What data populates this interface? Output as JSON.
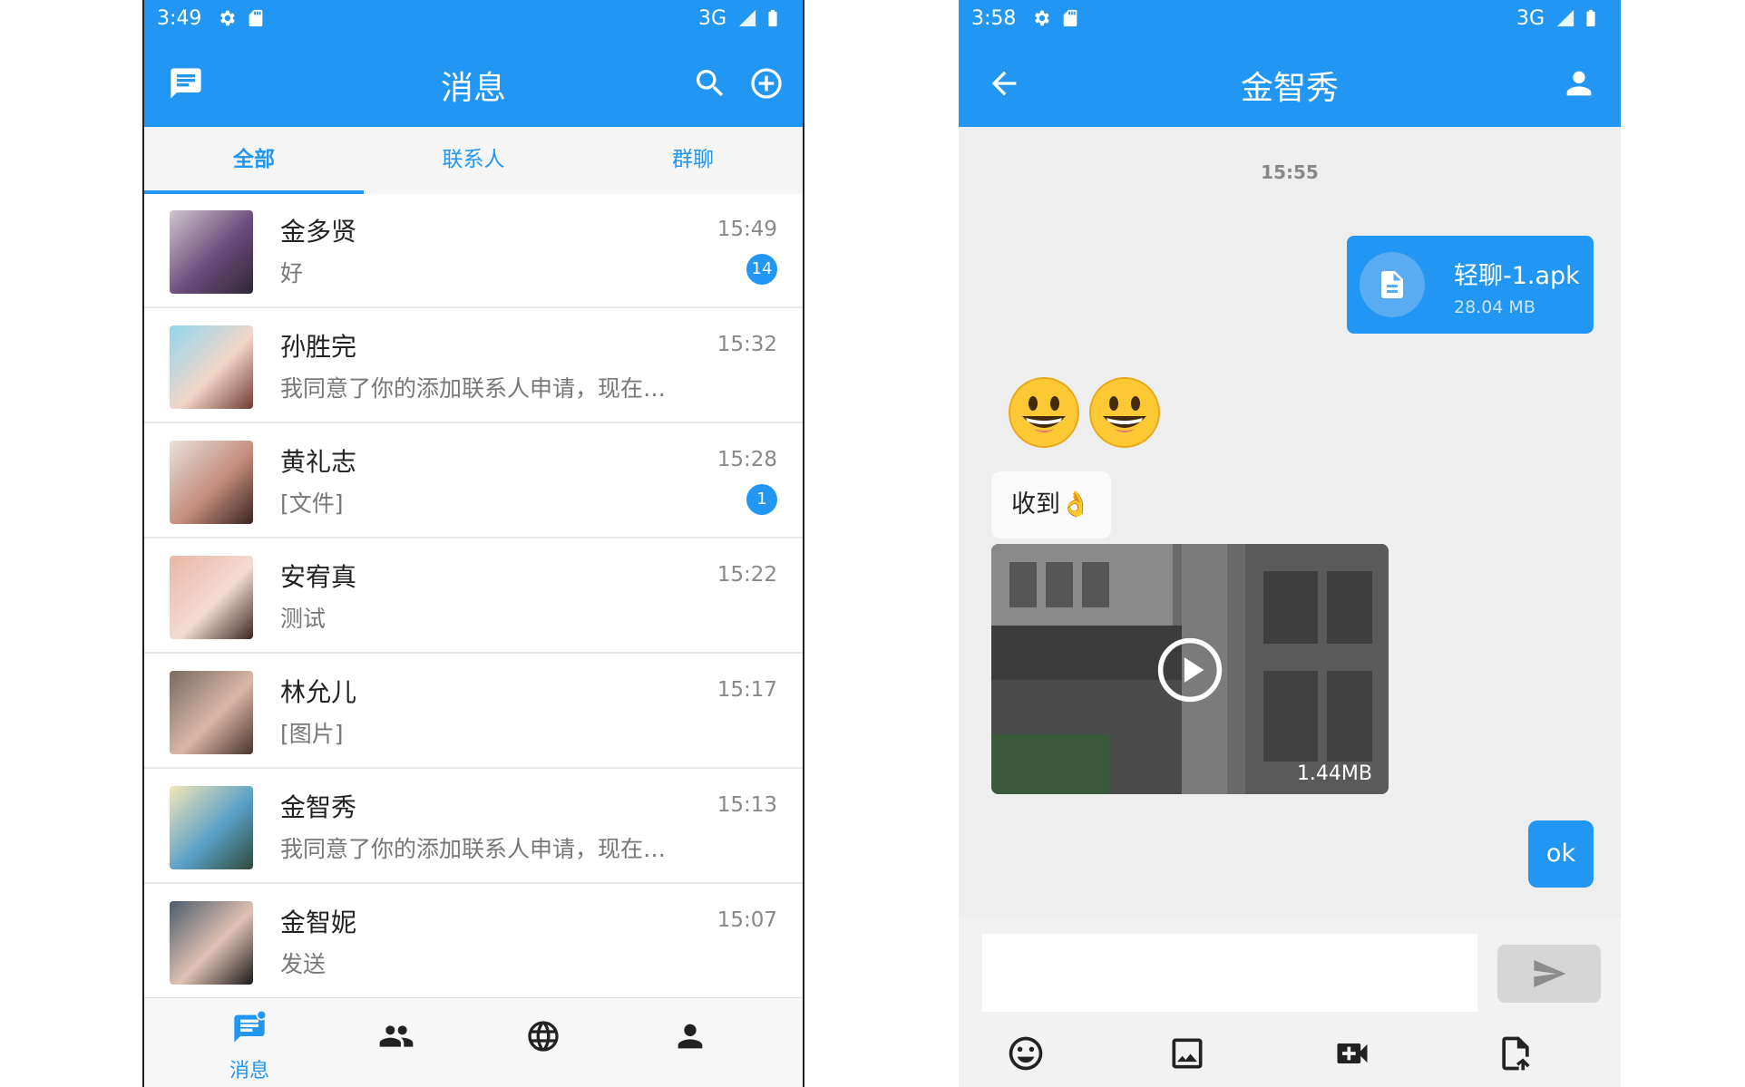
{
  "left": {
    "status": {
      "time": "3:49",
      "network": "3G"
    },
    "appbar": {
      "title": "消息"
    },
    "tabs": [
      {
        "label": "全部"
      },
      {
        "label": "联系人"
      },
      {
        "label": "群聊"
      }
    ],
    "conversations": [
      {
        "name": "金多贤",
        "preview": "好",
        "time": "15:49",
        "badge": "14"
      },
      {
        "name": "孙胜完",
        "preview": "我同意了你的添加联系人申请，现在…",
        "time": "15:32",
        "badge": ""
      },
      {
        "name": "黄礼志",
        "preview": "[文件]",
        "time": "15:28",
        "badge": "1"
      },
      {
        "name": "安宥真",
        "preview": "测试",
        "time": "15:22",
        "badge": ""
      },
      {
        "name": "林允儿",
        "preview": "[图片]",
        "time": "15:17",
        "badge": ""
      },
      {
        "name": "金智秀",
        "preview": "我同意了你的添加联系人申请，现在…",
        "time": "15:13",
        "badge": ""
      },
      {
        "name": "金智妮",
        "preview": "发送",
        "time": "15:07",
        "badge": ""
      }
    ],
    "bottomnav": {
      "messages_label": "消息"
    }
  },
  "right": {
    "status": {
      "time": "3:58",
      "network": "3G"
    },
    "appbar": {
      "title": "金智秀"
    },
    "chat": {
      "timestamp": "15:55",
      "file": {
        "name": "轻聊-1.apk",
        "size": "28.04 MB"
      },
      "text_message": "收到👌",
      "video": {
        "size": "1.44MB"
      },
      "ok_message": "ok"
    },
    "input": {
      "placeholder": ""
    }
  },
  "colors": {
    "primary": "#2196f3",
    "chat_bg": "#eeeeee"
  },
  "icons": [
    "message-icon",
    "search-icon",
    "add-circle-icon",
    "back-arrow-icon",
    "person-icon",
    "contacts-icon",
    "globe-icon",
    "send-icon",
    "emoji-icon",
    "image-icon",
    "video-icon",
    "file-icon",
    "play-icon",
    "settings-icon",
    "sd-card-icon",
    "signal-icon",
    "battery-icon"
  ]
}
